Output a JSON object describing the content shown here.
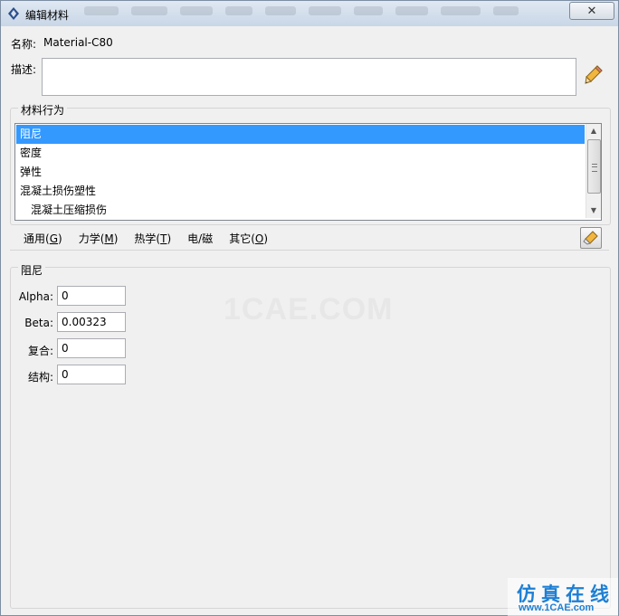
{
  "window": {
    "title": "编辑材料",
    "close_glyph": "✕",
    "icon": "abaqus-logo-icon"
  },
  "name_row": {
    "label": "名称:",
    "value": "Material-C80"
  },
  "description": {
    "label": "描述:",
    "value": "",
    "edit_icon": "pencil-icon"
  },
  "behaviors": {
    "group_title": "材料行为",
    "items": [
      {
        "label": "阻尼",
        "selected": true,
        "indent": 0
      },
      {
        "label": "密度",
        "selected": false,
        "indent": 0
      },
      {
        "label": "弹性",
        "selected": false,
        "indent": 0
      },
      {
        "label": "混凝土损伤塑性",
        "selected": false,
        "indent": 0
      },
      {
        "label": "混凝土压缩损伤",
        "selected": false,
        "indent": 1
      }
    ]
  },
  "menu": {
    "items": [
      {
        "text": "通用(",
        "key": "G",
        "end": ")"
      },
      {
        "text": "力学(",
        "key": "M",
        "end": ")"
      },
      {
        "text": "热学(",
        "key": "T",
        "end": ")"
      },
      {
        "text": "电/磁",
        "key": "",
        "end": ""
      },
      {
        "text": "其它(",
        "key": "O",
        "end": ")"
      }
    ],
    "erase_icon": "eraser-icon"
  },
  "damping": {
    "group_title": "阻尼",
    "fields": [
      {
        "label": "Alpha:",
        "value": "0"
      },
      {
        "label": "Beta:",
        "value": "0.00323"
      },
      {
        "label": "复合:",
        "value": "0"
      },
      {
        "label": "结构:",
        "value": "0"
      }
    ]
  },
  "watermark": {
    "text": "1CAE.COM"
  },
  "brand": {
    "cn": "仿真在线",
    "url": "www.1CAE.com"
  },
  "colors": {
    "selection": "#3399ff",
    "brand": "#1d7fd4"
  }
}
